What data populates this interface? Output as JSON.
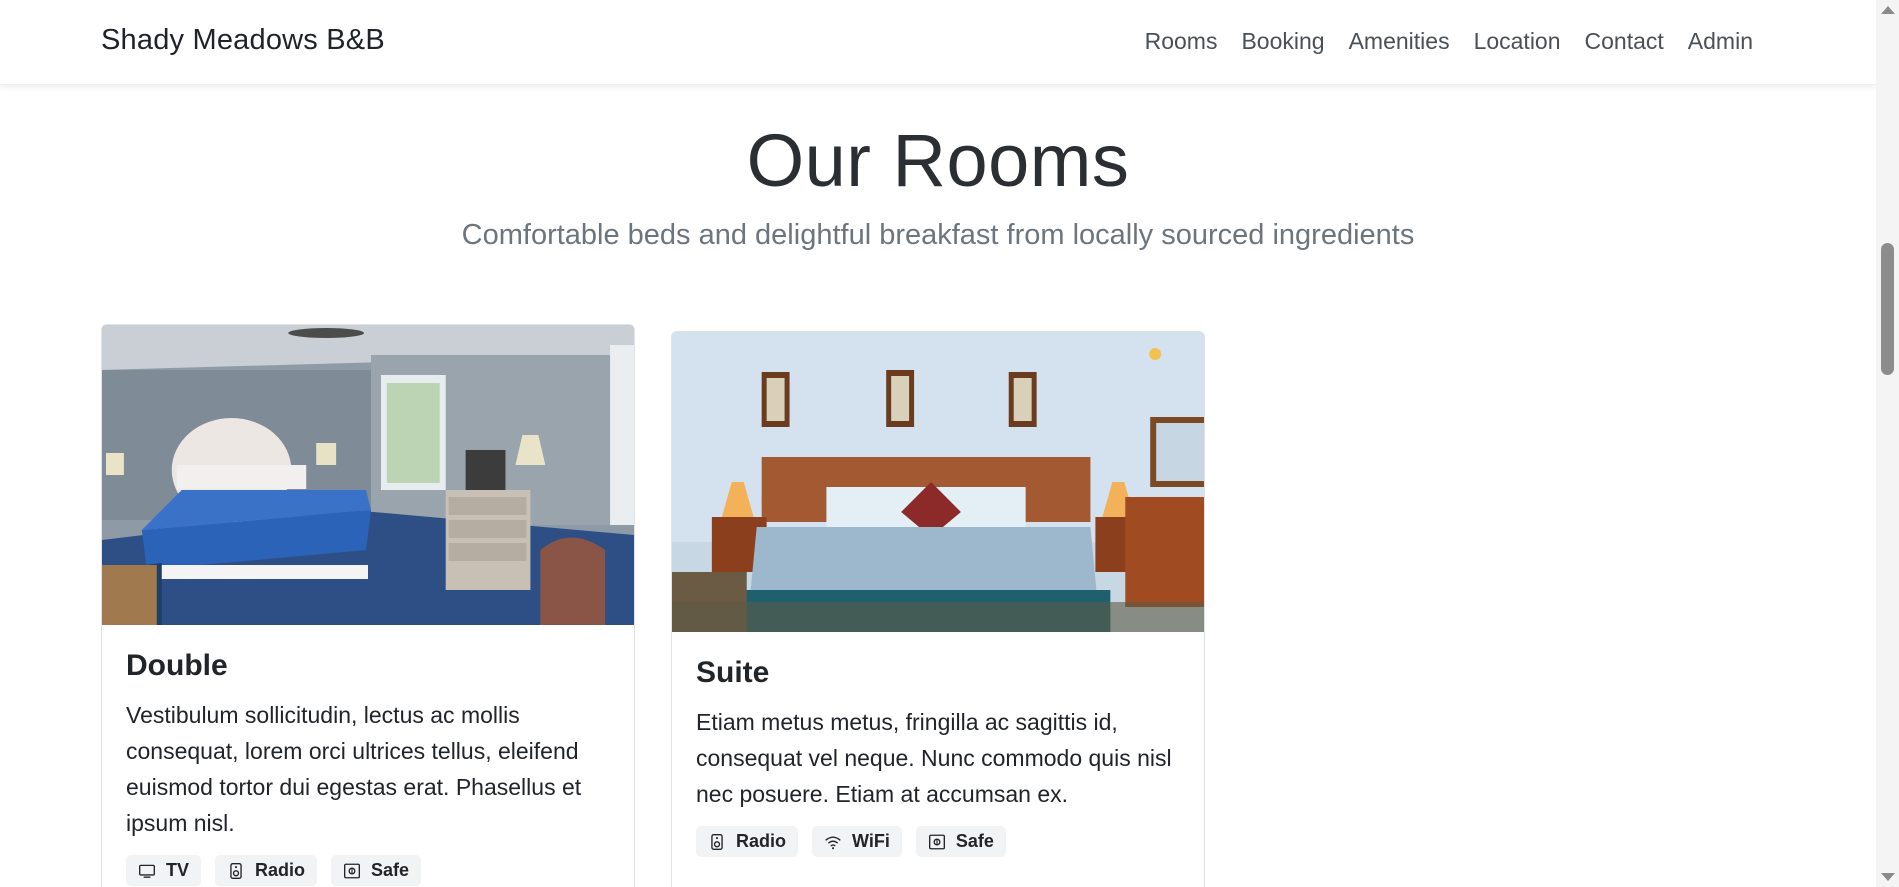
{
  "brand": "Shady Meadows B&B",
  "nav": [
    "Rooms",
    "Booking",
    "Amenities",
    "Location",
    "Contact",
    "Admin"
  ],
  "section": {
    "title": "Our Rooms",
    "subtitle": "Comfortable beds and delightful breakfast from locally sourced ingredients"
  },
  "rooms": [
    {
      "name": "Double",
      "description": "Vestibulum sollicitudin, lectus ac mollis consequat, lorem orci ultrices tellus, eleifend euismod tortor dui egestas erat. Phasellus et ipsum nisl.",
      "features": [
        {
          "label": "TV",
          "icon": "tv-icon"
        },
        {
          "label": "Radio",
          "icon": "radio-icon"
        },
        {
          "label": "Safe",
          "icon": "safe-icon"
        }
      ]
    },
    {
      "name": "Suite",
      "description": "Etiam metus metus, fringilla ac sagittis id, consequat vel neque. Nunc commodo quis nisl nec posuere. Etiam at accumsan ex.",
      "features": [
        {
          "label": "Radio",
          "icon": "radio-icon"
        },
        {
          "label": "WiFi",
          "icon": "wifi-icon"
        },
        {
          "label": "Safe",
          "icon": "safe-icon"
        }
      ]
    }
  ]
}
